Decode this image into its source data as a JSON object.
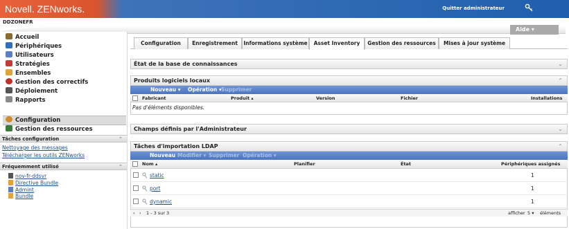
{
  "header": {
    "logo": "Novell. ZENworks.",
    "quit_label": "Quitter administrateur",
    "server_name": "DDZONEFR",
    "help_label": "Aide ▾"
  },
  "sidebar": {
    "nav_items": [
      {
        "label": "Accueil",
        "icon": "home-icon",
        "color": "#8a6b2f"
      },
      {
        "label": "Périphériques",
        "icon": "devices-icon",
        "color": "#2f6fbf"
      },
      {
        "label": "Utilisateurs",
        "icon": "user-icon",
        "color": "#5a7fc2"
      },
      {
        "label": "Stratégies",
        "icon": "policy-icon",
        "color": "#c23a3a"
      },
      {
        "label": "Ensembles",
        "icon": "bundle-icon",
        "color": "#e2a23b"
      },
      {
        "label": "Gestion des correctifs",
        "icon": "patch-icon",
        "color": "#c0302a"
      },
      {
        "label": "Déploiement",
        "icon": "deploy-icon",
        "color": "#555555"
      },
      {
        "label": "Rapports",
        "icon": "reports-icon",
        "color": "#8a8a8a"
      },
      {
        "label": "Configuration",
        "icon": "configuration-icon",
        "color": "#d08a2a"
      },
      {
        "label": "Gestion des ressources",
        "icon": "asset-icon",
        "color": "#3a7a3a"
      }
    ],
    "tasks_panel": {
      "title": "Tâches configuration",
      "links": [
        "Nettoyage des messages",
        "Télécharger les outils ZENworks"
      ]
    },
    "frequent_panel": {
      "title": "Fréquemment utilisé",
      "links": [
        {
          "label": "nov-fr-ddsvr",
          "icon": "server-icon"
        },
        {
          "label": "Directive Bundle",
          "icon": "bundle-icon"
        },
        {
          "label": "Admint",
          "icon": "admin-icon"
        },
        {
          "label": "Bundle",
          "icon": "bundle-icon"
        }
      ]
    }
  },
  "tabs": [
    "Configuration",
    "Enregistrement",
    "Informations système",
    "Asset Inventory",
    "Gestion des ressources",
    "Mises à jour système"
  ],
  "active_tab": "Asset Inventory",
  "sections": {
    "kb": {
      "title": "État de la base de connaissances"
    },
    "local_products": {
      "title": "Produits logiciels locaux",
      "toolbar": {
        "new": "Nouveau ▾",
        "operation": "Opération ▾",
        "delete": "Supprimer"
      },
      "columns": {
        "manufacturer": "Fabricant",
        "product": "Produit ▴",
        "version": "Version",
        "file": "Fichier",
        "installs": "Installations"
      },
      "empty_text": "Pas d'éléments disponibles."
    },
    "admin_fields": {
      "title": "Champs définis par l'Administrateur"
    },
    "ldap": {
      "title": "Tâches d'importation LDAP",
      "toolbar": {
        "new": "Nouveau",
        "edit": "Modifier ▾",
        "delete": "Supprimer",
        "operation": "Opération ▾"
      },
      "columns": {
        "name": "Nom ▴",
        "schedule": "Planifier",
        "state": "État",
        "devices": "Périphériques assignés"
      },
      "rows": [
        {
          "name": "static",
          "devices": "1"
        },
        {
          "name": "port",
          "devices": "1"
        },
        {
          "name": "dynamic",
          "devices": "1"
        }
      ],
      "pager": {
        "prev": "‹",
        "next": "›",
        "range": "1 - 3 sur 3",
        "show": "afficher",
        "per_page": "5 ▾",
        "items": "éléments"
      }
    }
  },
  "colors": {
    "accent_orange": "#e8613a",
    "header_blue": "#1f5fae",
    "toolbar_blue": "#4a74c0",
    "link_blue": "#24508a"
  }
}
